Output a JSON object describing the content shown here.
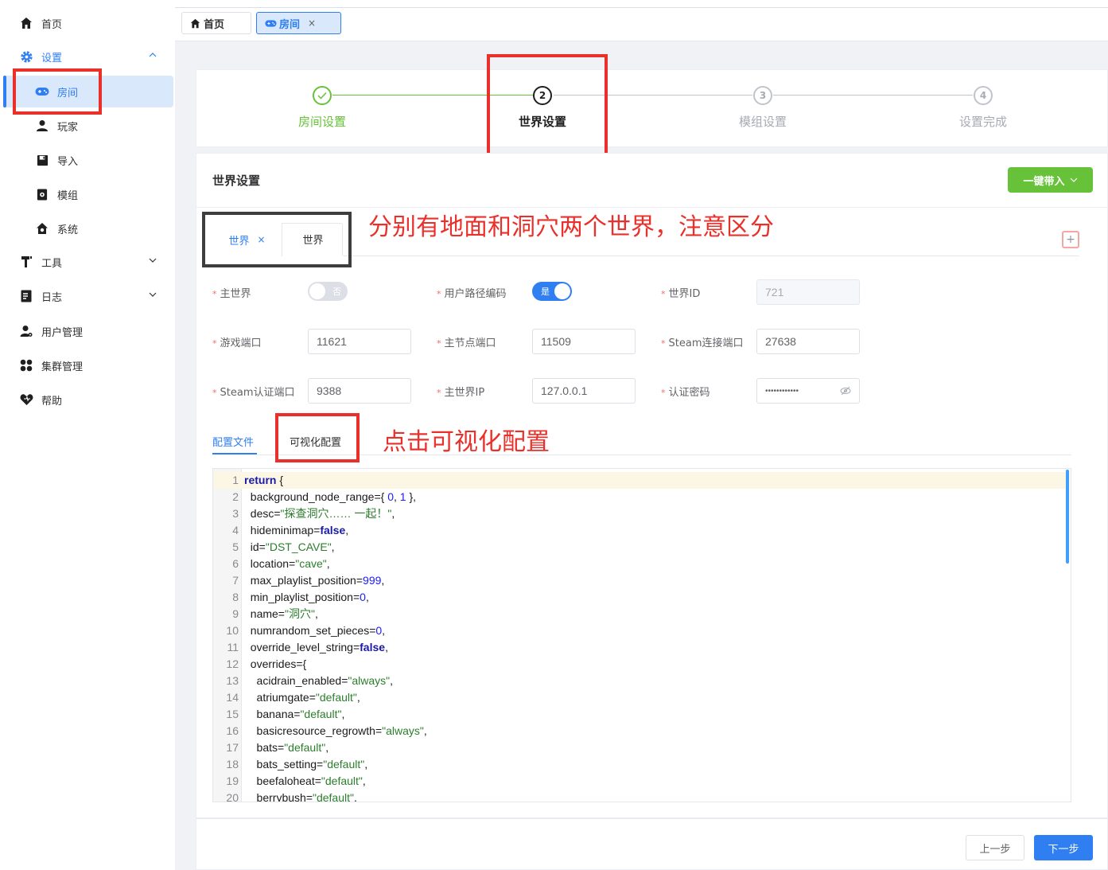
{
  "sidebar": {
    "items": [
      {
        "label": "首页",
        "icon": "home-icon"
      },
      {
        "label": "设置",
        "icon": "gear-icon"
      },
      {
        "label": "房间",
        "icon": "gamepad-icon"
      },
      {
        "label": "玩家",
        "icon": "user-icon"
      },
      {
        "label": "导入",
        "icon": "save-icon"
      },
      {
        "label": "模组",
        "icon": "puzzle-icon"
      },
      {
        "label": "系统",
        "icon": "house-gear-icon"
      },
      {
        "label": "工具",
        "icon": "tools-icon"
      },
      {
        "label": "日志",
        "icon": "log-icon"
      },
      {
        "label": "用户管理",
        "icon": "user-manage-icon"
      },
      {
        "label": "集群管理",
        "icon": "cluster-icon"
      },
      {
        "label": "帮助",
        "icon": "help-icon"
      }
    ]
  },
  "tabs": [
    {
      "label": "首页"
    },
    {
      "label": "房间",
      "close": "×"
    }
  ],
  "steps": [
    {
      "num": "",
      "title": "房间设置",
      "status": "done"
    },
    {
      "num": "2",
      "title": "世界设置",
      "status": "current"
    },
    {
      "num": "3",
      "title": "模组设置",
      "status": "pending"
    },
    {
      "num": "4",
      "title": "设置完成",
      "status": "pending"
    }
  ],
  "section": {
    "title": "世界设置",
    "one_click": "一键带入"
  },
  "world_tabs": [
    {
      "label": "世界",
      "close": "×"
    },
    {
      "label": "世界"
    }
  ],
  "add_icon": "+",
  "annotations": {
    "worlds": "分别有地面和洞穴两个世界，注意区分",
    "visual": "点击可视化配置"
  },
  "form": {
    "main_world": {
      "label": "主世界",
      "value": "否"
    },
    "user_path_encode": {
      "label": "用户路径编码",
      "value": "是"
    },
    "world_id": {
      "label": "世界ID",
      "placeholder": "721"
    },
    "game_port": {
      "label": "游戏端口",
      "value": "11621"
    },
    "master_port": {
      "label": "主节点端口",
      "value": "11509"
    },
    "steam_conn_port": {
      "label": "Steam连接端口",
      "value": "27638"
    },
    "steam_auth_port": {
      "label": "Steam认证端口",
      "value": "9388"
    },
    "master_ip": {
      "label": "主世界IP",
      "value": "127.0.0.1"
    },
    "auth_password": {
      "label": "认证密码",
      "value": "••••••••••••"
    }
  },
  "config_tabs": [
    {
      "label": "配置文件"
    },
    {
      "label": "可视化配置"
    }
  ],
  "code_lines": [
    {
      "n": "1",
      "parts": [
        [
          "kw",
          "return"
        ],
        [
          "t",
          " {"
        ]
      ]
    },
    {
      "n": "2",
      "parts": [
        [
          "t",
          "  background_node_range={ "
        ],
        [
          "num",
          "0"
        ],
        [
          "t",
          ", "
        ],
        [
          "num",
          "1"
        ],
        [
          "t",
          " },"
        ]
      ]
    },
    {
      "n": "3",
      "parts": [
        [
          "t",
          "  desc="
        ],
        [
          "str",
          "\"探查洞穴…… 一起！\""
        ],
        [
          "t",
          ","
        ]
      ]
    },
    {
      "n": "4",
      "parts": [
        [
          "t",
          "  hideminimap="
        ],
        [
          "kw",
          "false"
        ],
        [
          "t",
          ","
        ]
      ]
    },
    {
      "n": "5",
      "parts": [
        [
          "t",
          "  id="
        ],
        [
          "str",
          "\"DST_CAVE\""
        ],
        [
          "t",
          ","
        ]
      ]
    },
    {
      "n": "6",
      "parts": [
        [
          "t",
          "  location="
        ],
        [
          "str",
          "\"cave\""
        ],
        [
          "t",
          ","
        ]
      ]
    },
    {
      "n": "7",
      "parts": [
        [
          "t",
          "  max_playlist_position="
        ],
        [
          "num",
          "999"
        ],
        [
          "t",
          ","
        ]
      ]
    },
    {
      "n": "8",
      "parts": [
        [
          "t",
          "  min_playlist_position="
        ],
        [
          "num",
          "0"
        ],
        [
          "t",
          ","
        ]
      ]
    },
    {
      "n": "9",
      "parts": [
        [
          "t",
          "  name="
        ],
        [
          "str",
          "\"洞穴\""
        ],
        [
          "t",
          ","
        ]
      ]
    },
    {
      "n": "10",
      "parts": [
        [
          "t",
          "  numrandom_set_pieces="
        ],
        [
          "num",
          "0"
        ],
        [
          "t",
          ","
        ]
      ]
    },
    {
      "n": "11",
      "parts": [
        [
          "t",
          "  override_level_string="
        ],
        [
          "kw",
          "false"
        ],
        [
          "t",
          ","
        ]
      ]
    },
    {
      "n": "12",
      "parts": [
        [
          "t",
          "  overrides={"
        ]
      ]
    },
    {
      "n": "13",
      "parts": [
        [
          "t",
          "    acidrain_enabled="
        ],
        [
          "str",
          "\"always\""
        ],
        [
          "t",
          ","
        ]
      ]
    },
    {
      "n": "14",
      "parts": [
        [
          "t",
          "    atriumgate="
        ],
        [
          "str",
          "\"default\""
        ],
        [
          "t",
          ","
        ]
      ]
    },
    {
      "n": "15",
      "parts": [
        [
          "t",
          "    banana="
        ],
        [
          "str",
          "\"default\""
        ],
        [
          "t",
          ","
        ]
      ]
    },
    {
      "n": "16",
      "parts": [
        [
          "t",
          "    basicresource_regrowth="
        ],
        [
          "str",
          "\"always\""
        ],
        [
          "t",
          ","
        ]
      ]
    },
    {
      "n": "17",
      "parts": [
        [
          "t",
          "    bats="
        ],
        [
          "str",
          "\"default\""
        ],
        [
          "t",
          ","
        ]
      ]
    },
    {
      "n": "18",
      "parts": [
        [
          "t",
          "    bats_setting="
        ],
        [
          "str",
          "\"default\""
        ],
        [
          "t",
          ","
        ]
      ]
    },
    {
      "n": "19",
      "parts": [
        [
          "t",
          "    beefaloheat="
        ],
        [
          "str",
          "\"default\""
        ],
        [
          "t",
          ","
        ]
      ]
    },
    {
      "n": "20",
      "parts": [
        [
          "t",
          "    berrybush="
        ],
        [
          "str",
          "\"default\""
        ],
        [
          "t",
          ","
        ]
      ]
    }
  ],
  "footer": {
    "prev": "上一步",
    "next": "下一步"
  },
  "colors": {
    "primary": "#2f7ff3",
    "success": "#67c23a",
    "annotation": "#e9302b"
  }
}
